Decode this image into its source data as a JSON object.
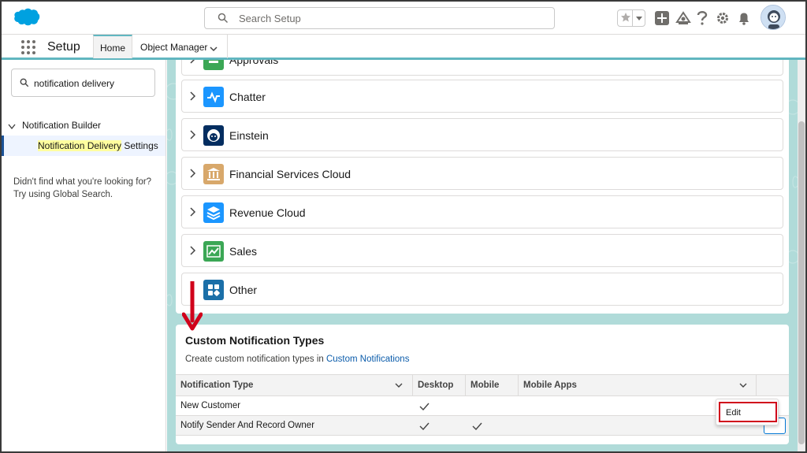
{
  "header": {
    "search_placeholder": "Search Setup"
  },
  "nav": {
    "app_name": "Setup",
    "tabs": [
      {
        "label": "Home"
      },
      {
        "label": "Object Manager"
      }
    ]
  },
  "sidebar": {
    "quick_find_value": "notification delivery",
    "tree": {
      "parent": "Notification Builder",
      "child_highlight": "Notification Delivery",
      "child_rest": " Settings"
    },
    "not_found": "Didn't find what you're looking for? Try using Global Search."
  },
  "accordion": {
    "items": [
      {
        "label": "Approvals",
        "icon": "approvals-icon",
        "color": "#3ba755"
      },
      {
        "label": "Chatter",
        "icon": "chatter-icon",
        "color": "#1b96ff"
      },
      {
        "label": "Einstein",
        "icon": "einstein-icon",
        "color": "#032d60"
      },
      {
        "label": "Financial Services Cloud",
        "icon": "bank-icon",
        "color": "#d8a86b"
      },
      {
        "label": "Revenue Cloud",
        "icon": "layers-icon",
        "color": "#1b96ff"
      },
      {
        "label": "Sales",
        "icon": "sales-chart-icon",
        "color": "#3ba755"
      },
      {
        "label": "Other",
        "icon": "apps-grid-icon",
        "color": "#1b6fa8"
      }
    ]
  },
  "custom_types": {
    "title": "Custom Notification Types",
    "desc_prefix": "Create custom notification types in ",
    "desc_link": "Custom Notifications",
    "columns": [
      "Notification Type",
      "Desktop",
      "Mobile",
      "Mobile Apps"
    ],
    "rows": [
      {
        "name": "New Customer",
        "desktop": true,
        "mobile": false
      },
      {
        "name": "Notify Sender And Record Owner",
        "desktop": true,
        "mobile": true
      }
    ],
    "row_menu": {
      "label": "Edit"
    }
  },
  "colors": {
    "accent": "#0176d3",
    "annotation": "#d0021b",
    "nav_underline": "#61b6c0",
    "main_bg": "#b0dbd9"
  }
}
